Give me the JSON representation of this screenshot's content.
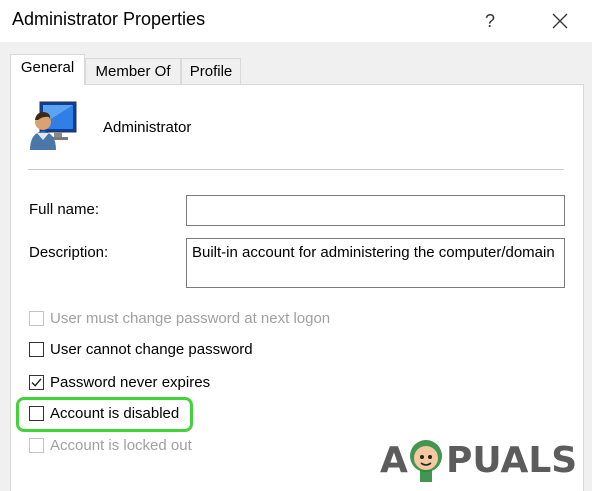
{
  "window": {
    "title": "Administrator Properties"
  },
  "titlebar": {
    "help_glyph": "?",
    "close_icon": "close-icon"
  },
  "tabs": [
    {
      "label": "General",
      "active": true
    },
    {
      "label": "Member Of",
      "active": false
    },
    {
      "label": "Profile",
      "active": false
    }
  ],
  "user": {
    "name": "Administrator",
    "icon": "user-monitor-icon"
  },
  "form": {
    "full_name": {
      "label": "Full name:",
      "value": ""
    },
    "description": {
      "label": "Description:",
      "value": "Built-in account for administering the computer/domain"
    }
  },
  "options": [
    {
      "label": "User must change password at next logon",
      "checked": false,
      "enabled": false
    },
    {
      "label": "User cannot change password",
      "checked": false,
      "enabled": true
    },
    {
      "label": "Password never expires",
      "checked": true,
      "enabled": true
    },
    {
      "label": "Account is disabled",
      "checked": false,
      "enabled": true,
      "highlighted": true
    },
    {
      "label": "Account is locked out",
      "checked": false,
      "enabled": false
    }
  ],
  "watermark": {
    "text": "A PUALS"
  },
  "colors": {
    "highlight": "#44d23c",
    "dialog_bg": "#f0f0f0",
    "disabled_text": "#a0a0a0"
  }
}
